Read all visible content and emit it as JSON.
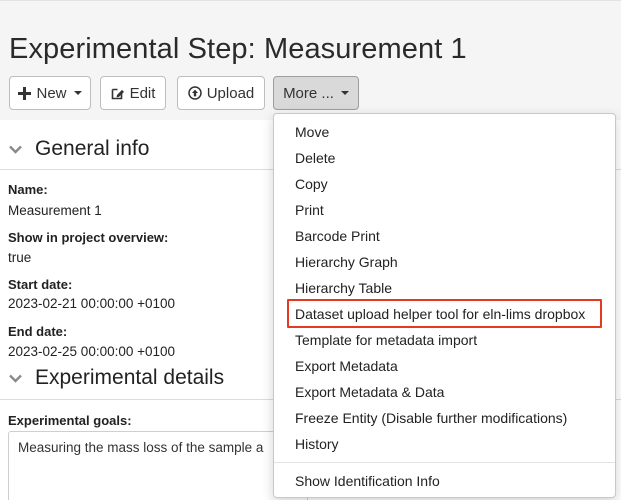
{
  "title": "Experimental Step: Measurement 1",
  "toolbar": {
    "new_label": "New",
    "edit_label": "Edit",
    "upload_label": "Upload",
    "more_label": "More ..."
  },
  "general_info": {
    "title": "General info",
    "fields": [
      {
        "label": "Name:",
        "value": "Measurement 1"
      },
      {
        "label": "Show in project overview:",
        "value": "true"
      },
      {
        "label": "Start date:",
        "value": "2023-02-21 00:00:00 +0100"
      },
      {
        "label": "End date:",
        "value": "2023-02-25 00:00:00 +0100"
      }
    ]
  },
  "experimental_details": {
    "title": "Experimental details",
    "goals_label": "Experimental goals:",
    "goals_value": "Measuring the mass loss of the sample a"
  },
  "more_menu": {
    "items": [
      "Move",
      "Delete",
      "Copy",
      "Print",
      "Barcode Print",
      "Hierarchy Graph",
      "Hierarchy Table",
      "Dataset upload helper tool for eln-lims dropbox",
      "Template for metadata import",
      "Export Metadata",
      "Export Metadata & Data",
      "Freeze Entity (Disable further modifications)",
      "History"
    ],
    "footer_item": "Show Identification Info",
    "highlighted_item": "Dataset upload helper tool for eln-lims dropbox"
  },
  "colors": {
    "highlight": "#e53a22",
    "header_background": "#f5f5f5",
    "active_button": "#d9d9d9"
  },
  "icons": [
    "plus-icon",
    "edit-icon",
    "upload-icon",
    "chevron-down-icon",
    "caret-down-icon"
  ]
}
